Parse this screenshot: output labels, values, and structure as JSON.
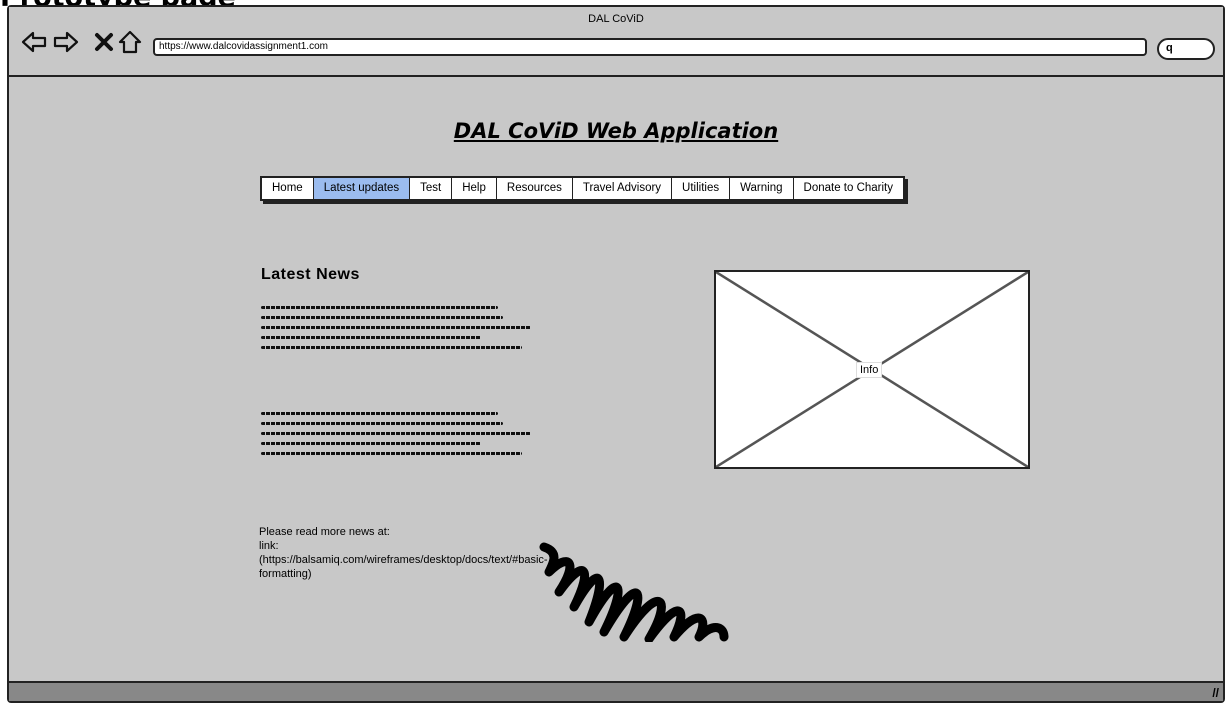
{
  "page": {
    "heading": "Prototype page"
  },
  "window": {
    "title": "DAL CoViD"
  },
  "browser": {
    "url": "https://www.dalcovidassignment1.com",
    "icons": [
      "back-arrow-icon",
      "forward-arrow-icon",
      "close-icon",
      "home-icon",
      "search-icon"
    ]
  },
  "app": {
    "title": "DAL CoViD Web Application"
  },
  "menu": {
    "items": [
      {
        "label": "Home",
        "active": false
      },
      {
        "label": "Latest updates",
        "active": true
      },
      {
        "label": "Test",
        "active": false
      },
      {
        "label": "Help",
        "active": false
      },
      {
        "label": "Resources",
        "active": false
      },
      {
        "label": "Travel Advisory",
        "active": false
      },
      {
        "label": "Utilities",
        "active": false
      },
      {
        "label": "Warning",
        "active": false
      },
      {
        "label": "Donate to Charity",
        "active": false
      }
    ],
    "active_color": "#9bbcef"
  },
  "news": {
    "heading": "Latest News",
    "read_more": "Please read more news at:\nlink:\n(https://balsamiq.com/wireframes/desktop/docs/text/#basic-formatting)"
  },
  "image_placeholder": {
    "label": "Info"
  }
}
